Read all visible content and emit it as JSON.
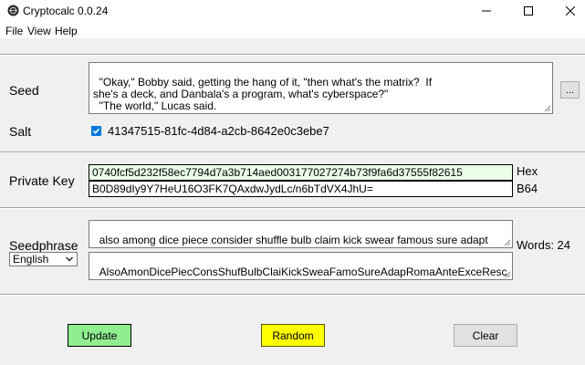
{
  "window": {
    "title": "Cryptocalc 0.0.24",
    "minimize_glyph": "—",
    "maximize_glyph": "☐",
    "close_glyph": "✕"
  },
  "menu": [
    "File",
    "View",
    "Help"
  ],
  "seed": {
    "label": "Seed",
    "text": "\"Okay,\" Bobby said, getting the hang of it, \"then what's the matrix?  If\nshe's a deck, and Danbala's a program, what's cyberspace?\"\n  \"The world,\" Lucas said.\n-- William Gibson, _Count Zero_",
    "browse_label": "..."
  },
  "salt": {
    "label": "Salt",
    "checked": true,
    "value": "41347515-81fc-4d84-a2cb-8642e0c3ebe7"
  },
  "private_key": {
    "label": "Private Key",
    "hex_value": "0740fcf5d232f58ec7794d7a3b714aed003177027274b73f9fa6d37555f82615",
    "hex_label": "Hex",
    "b64_value": "B0D89dIy9Y7HeU16O3FK7QAxdwJydLc/n6bTdVX4JhU=",
    "b64_label": "B64"
  },
  "seedphrase": {
    "label": "Seedphrase",
    "language": "English",
    "words": "also among dice piece consider shuffle bulb claim kick swear famous sure adapt romance antenna excess rescue woman trust plunge fetch winter obscure resemble",
    "word_count_label": "Words: 24",
    "short": "AlsoAmonDicePiecConsShufBulbClaiKickSweaFamoSureAdapRomaAnteExceRescWomaTrusPlunFetcWintObscRese"
  },
  "buttons": {
    "update": "Update",
    "random": "Random",
    "clear": "Clear"
  },
  "colors": {
    "hex_field_bg": "#eaffea",
    "update_bg": "#90ee90",
    "random_bg": "#ffff00",
    "clear_bg": "#e1e1e1",
    "content_bg": "#f0f0f0",
    "check_blue": "#0078d7"
  }
}
